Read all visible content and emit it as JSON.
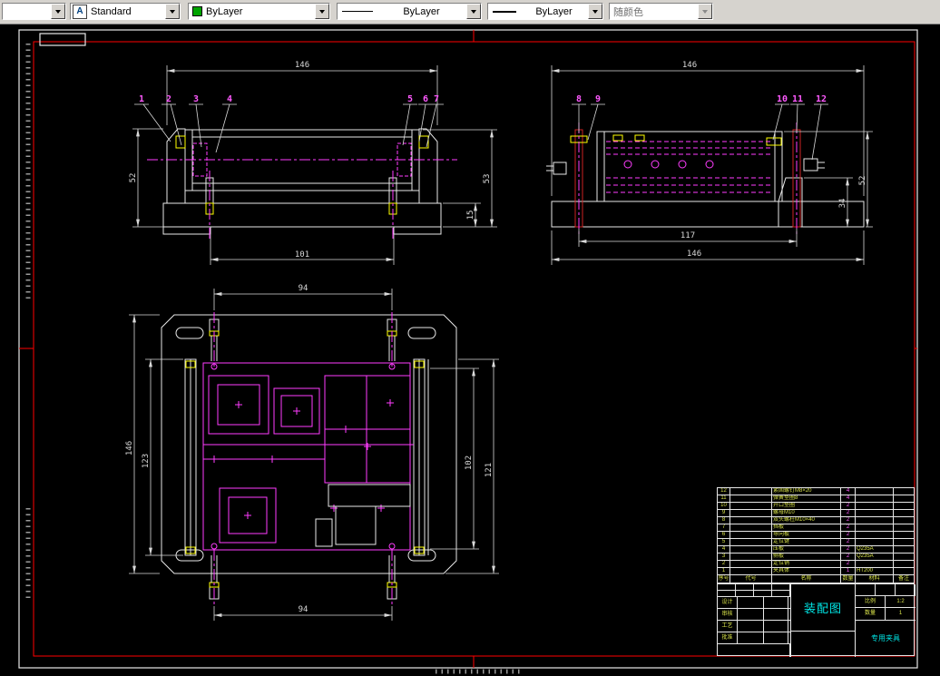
{
  "toolbar": {
    "layer_combo": {
      "value": ""
    },
    "style_combo": {
      "value": "Standard",
      "icon": "A"
    },
    "color_combo": {
      "value": "ByLayer"
    },
    "linetype_combo": {
      "value": "ByLayer"
    },
    "lineweight_combo": {
      "value": "ByLayer"
    },
    "plotstyle_combo": {
      "value": "随颜色"
    }
  },
  "colors": {
    "outline": "#e8e8e8",
    "detail": "#ff3dff",
    "balloon": "#ff5aff",
    "dimension": "#d9d9d9",
    "screw": "#ffff00",
    "rod": "#cc2222",
    "hatch": "#8fdcdc",
    "frame": "#e8e8e8",
    "inner_frame": "#ff0000",
    "title_cyan": "#00e5e5",
    "bom_text": "#d8e24a",
    "swatch": "#00a400"
  },
  "drawing": {
    "balloons": {
      "front": [
        "1",
        "2",
        "3",
        "4",
        "5",
        "6",
        "7"
      ],
      "side": [
        "8",
        "9",
        "10",
        "11",
        "12"
      ]
    },
    "dims": {
      "front": {
        "top": "146",
        "left": "52",
        "right": "53",
        "base": "15",
        "bottom": "101"
      },
      "side": {
        "top": "146",
        "inner": "117",
        "bottom": "146",
        "support": "34",
        "right": "52"
      },
      "plan": {
        "top": "94",
        "left_outer": "146",
        "left_inner": "123",
        "right_inner": "102",
        "right_outer": "121",
        "bottom": "94"
      }
    }
  },
  "bom": {
    "header": {
      "no": "序号",
      "code": "代号",
      "name": "名称",
      "qty": "数量",
      "material": "材料",
      "note": "备注"
    },
    "rows": [
      {
        "no": "12",
        "code": "",
        "name": "紧固螺钉M8×20",
        "qty": "4",
        "material": "",
        "note": ""
      },
      {
        "no": "11",
        "code": "",
        "name": "弹簧垫圈8",
        "qty": "4",
        "material": "",
        "note": ""
      },
      {
        "no": "10",
        "code": "",
        "name": "开口垫圈",
        "qty": "2",
        "material": "",
        "note": ""
      },
      {
        "no": "9",
        "code": "",
        "name": "螺母M10",
        "qty": "2",
        "material": "",
        "note": ""
      },
      {
        "no": "8",
        "code": "",
        "name": "双头螺柱M10×40",
        "qty": "2",
        "material": "",
        "note": ""
      },
      {
        "no": "7",
        "code": "",
        "name": "挡板",
        "qty": "2",
        "material": "",
        "note": ""
      },
      {
        "no": "6",
        "code": "",
        "name": "导向板",
        "qty": "2",
        "material": "",
        "note": ""
      },
      {
        "no": "5",
        "code": "",
        "name": "定位键",
        "qty": "2",
        "material": "",
        "note": ""
      },
      {
        "no": "4",
        "code": "",
        "name": "压板",
        "qty": "2",
        "material": "Q235A",
        "note": ""
      },
      {
        "no": "3",
        "code": "",
        "name": "侧板",
        "qty": "2",
        "material": "Q235A",
        "note": ""
      },
      {
        "no": "2",
        "code": "",
        "name": "定位销",
        "qty": "2",
        "material": "",
        "note": ""
      },
      {
        "no": "1",
        "code": "",
        "name": "夹具体",
        "qty": "1",
        "material": "HT200",
        "note": ""
      }
    ]
  },
  "titleblock": {
    "title": "装配图",
    "doc_name": "专用夹具",
    "labels": {
      "design": "设计",
      "check": "审核",
      "craft": "工艺",
      "approve": "批准",
      "scale": "比例",
      "scale_value": "1:2",
      "count": "数量",
      "count_value": "1"
    }
  }
}
